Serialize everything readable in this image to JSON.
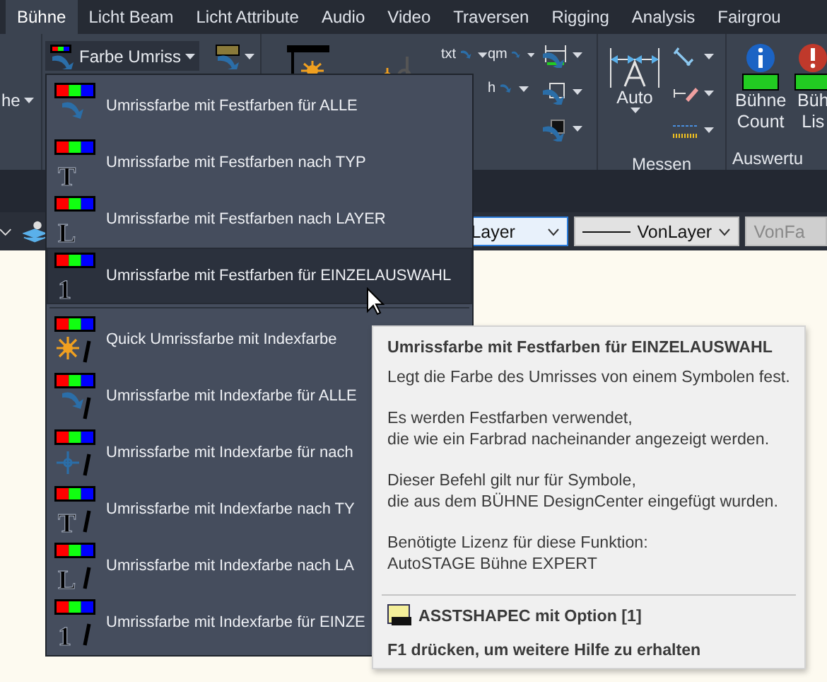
{
  "tabs": [
    {
      "label": "Bühne",
      "selected": true
    },
    {
      "label": "Licht Beam",
      "selected": false
    },
    {
      "label": "Licht Attribute",
      "selected": false
    },
    {
      "label": "Audio",
      "selected": false
    },
    {
      "label": "Video",
      "selected": false
    },
    {
      "label": "Traversen",
      "selected": false
    },
    {
      "label": "Rigging",
      "selected": false
    },
    {
      "label": "Analysis",
      "selected": false
    },
    {
      "label": "Fairgrou",
      "selected": false
    }
  ],
  "ribbon": {
    "left_button": "he",
    "outline_color_button": "Farbe Umriss",
    "text_tools": [
      "txt",
      "qm",
      "h"
    ],
    "measure": {
      "button": "Auto",
      "panel_label": "Messen"
    },
    "evaluation": {
      "buttons": [
        {
          "lines": [
            "Bühne",
            "Count"
          ],
          "kind": "info"
        },
        {
          "lines": [
            "Büh",
            "Lis"
          ],
          "kind": "alert"
        }
      ],
      "panel_label": "Auswertu"
    }
  },
  "property_bar": {
    "layer": "Layer",
    "linetype": "VonLayer",
    "color_field": "VonFa"
  },
  "menu": {
    "sections": [
      {
        "items": [
          {
            "label": "Umrissfarbe mit Festfarben für ALLE",
            "kind": "arrow",
            "indexed": false,
            "selected": false
          },
          {
            "label": "Umrissfarbe mit Festfarben nach TYP",
            "kind": "letter",
            "glyph": "T",
            "indexed": false,
            "selected": false
          },
          {
            "label": "Umrissfarbe mit Festfarben nach LAYER",
            "kind": "letter",
            "glyph": "L",
            "indexed": false,
            "selected": false
          },
          {
            "label": "Umrissfarbe mit Festfarben für EINZELAUSWAHL",
            "kind": "letter",
            "glyph": "1",
            "indexed": false,
            "selected": true
          }
        ]
      },
      {
        "items": [
          {
            "label": "Quick Umrissfarbe mit Indexfarbe",
            "kind": "sun",
            "indexed": true,
            "selected": false
          },
          {
            "label": "Umrissfarbe mit Indexfarbe für ALLE",
            "kind": "arrow",
            "indexed": true,
            "selected": false
          },
          {
            "label": "Umrissfarbe mit Indexfarbe für nach",
            "kind": "cross",
            "indexed": true,
            "selected": false
          },
          {
            "label": "Umrissfarbe mit Indexfarbe nach TY",
            "kind": "letter",
            "glyph": "T",
            "indexed": true,
            "selected": false
          },
          {
            "label": "Umrissfarbe mit Indexfarbe nach LA",
            "kind": "letter",
            "glyph": "L",
            "indexed": true,
            "selected": false
          },
          {
            "label": "Umrissfarbe mit Indexfarbe für EINZE",
            "kind": "letter",
            "glyph": "1",
            "indexed": true,
            "selected": false
          }
        ]
      }
    ]
  },
  "tooltip": {
    "title": "Umrissfarbe mit Festfarben für EINZELAUSWAHL",
    "paragraphs": [
      [
        "Legt die Farbe des Umrisses von einem Symbolen fest."
      ],
      [
        "Es werden Festfarben verwendet,",
        "die wie ein Farbrad nacheinander angezeigt werden."
      ],
      [
        "Dieser Befehl gilt nur für Symbole,",
        "die aus dem BÜHNE DesignCenter eingefügt wurden."
      ],
      [
        "Benötigte Lizenz für diese Funktion:",
        "AutoSTAGE Bühne EXPERT"
      ]
    ],
    "command": "ASSTSHAPEC mit Option [1]",
    "help": "F1 drücken, um weitere Hilfe zu erhalten"
  }
}
